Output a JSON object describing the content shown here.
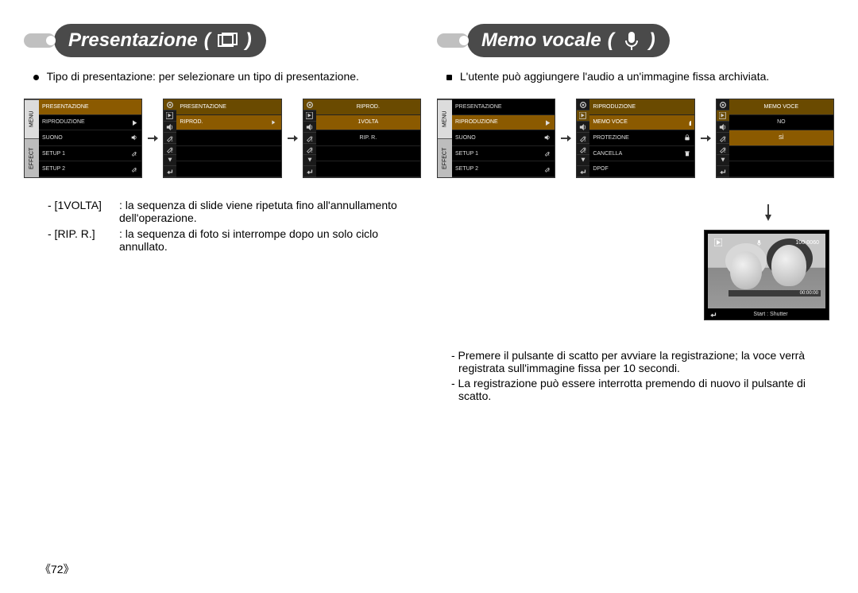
{
  "left": {
    "title": "Presentazione",
    "intro": "Tipo di presentazione: per selezionare un tipo di presentazione.",
    "menu1": {
      "side_tabs": [
        "MENU",
        "EFFECT"
      ],
      "rows": [
        {
          "label": "PRESENTAZIONE",
          "sel": true
        },
        {
          "label": "RIPRODUZIONE",
          "icon": "play"
        },
        {
          "label": "SUONO",
          "icon": "sound"
        },
        {
          "label": "SETUP 1",
          "icon": "wrench1"
        },
        {
          "label": "SETUP 2",
          "icon": "wrench2"
        }
      ]
    },
    "menu2": {
      "header": "PRESENTAZIONE",
      "rows": [
        {
          "label": "RIPROD.",
          "sel": true,
          "icon": "right"
        },
        {
          "label": ""
        },
        {
          "label": ""
        },
        {
          "label": ""
        }
      ]
    },
    "menu3": {
      "header": "RIPROD.",
      "rows": [
        {
          "label": "1VOLTA",
          "sel": true
        },
        {
          "label": "RIP. R."
        },
        {
          "label": ""
        },
        {
          "label": ""
        }
      ]
    },
    "defs": [
      {
        "key": "- [1VOLTA]",
        "val": ": la sequenza di slide viene ripetuta fino all'annullamento dell'operazione."
      },
      {
        "key": "- [RIP. R.]",
        "val": ": la sequenza di foto si interrompe dopo un solo ciclo annullato."
      }
    ]
  },
  "right": {
    "title": "Memo vocale",
    "intro": "L'utente può aggiungere l'audio a un'immagine fissa archiviata.",
    "menu1": {
      "side_tabs": [
        "MENU",
        "EFFECT"
      ],
      "rows": [
        {
          "label": "PRESENTAZIONE"
        },
        {
          "label": "RIPRODUZIONE",
          "sel": true,
          "icon": "play"
        },
        {
          "label": "SUONO",
          "icon": "sound"
        },
        {
          "label": "SETUP 1",
          "icon": "wrench1"
        },
        {
          "label": "SETUP 2",
          "icon": "wrench2"
        }
      ]
    },
    "menu2": {
      "header": "RIPRODUZIONE",
      "rows": [
        {
          "label": "MEMO VOCE",
          "sel": true,
          "icon": "mic"
        },
        {
          "label": "PROTEZIONE",
          "icon": "lock"
        },
        {
          "label": "CANCELLA",
          "icon": "trash"
        },
        {
          "label": "DPOF"
        }
      ]
    },
    "menu3": {
      "header": "MEMO VOCE",
      "rows": [
        {
          "label": "NO",
          "sel": false
        },
        {
          "label": "SÌ",
          "sel": true
        },
        {
          "label": ""
        },
        {
          "label": ""
        }
      ]
    },
    "photo": {
      "file": "100-0060",
      "time": "00:00:00",
      "hint": "Start : Shutter"
    },
    "notes": [
      "- Premere il pulsante di scatto per avviare la registrazione; la voce verrà registrata sull'immagine fissa per 10 secondi.",
      "- La registrazione può essere interrotta premendo di nuovo il pulsante di scatto."
    ]
  },
  "page_number": "《72》"
}
